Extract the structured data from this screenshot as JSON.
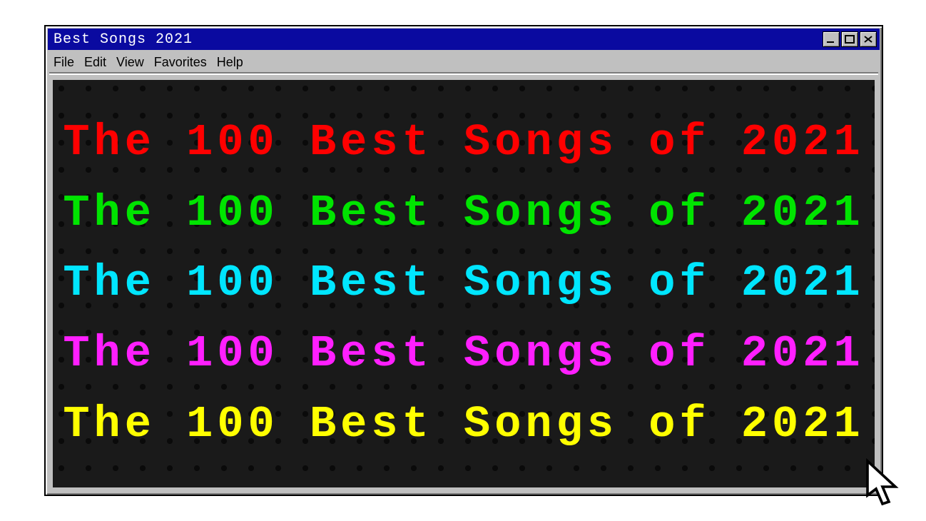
{
  "window": {
    "title": "Best Songs 2021",
    "controls": {
      "min": "minimize",
      "max": "maximize",
      "close": "close"
    }
  },
  "menu": {
    "file": "File",
    "edit": "Edit",
    "view": "View",
    "favorites": "Favorites",
    "help": "Help"
  },
  "headline": "The 100 Best Songs of 2021",
  "colors": {
    "red": "#ff0000",
    "green": "#00e400",
    "cyan": "#00e6ff",
    "magenta": "#ff1fff",
    "yellow": "#ffff00"
  }
}
